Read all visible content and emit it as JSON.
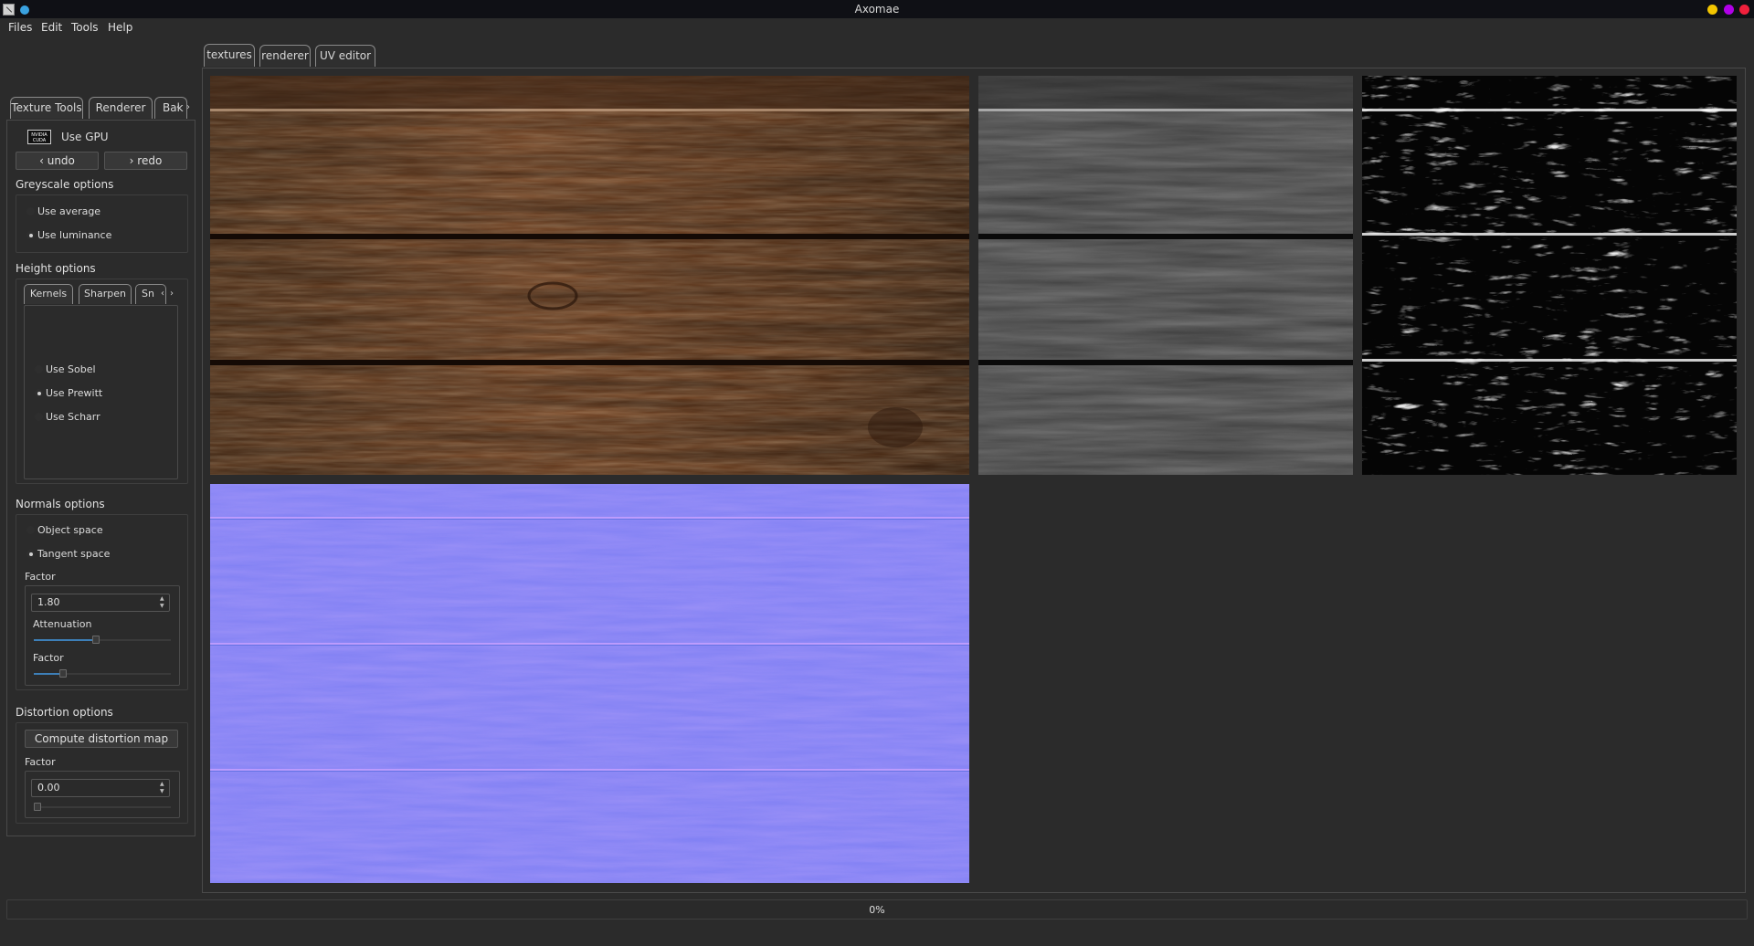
{
  "window": {
    "title": "Axomae"
  },
  "menu": [
    "Files",
    "Edit",
    "Tools",
    "Help"
  ],
  "left_tabs": [
    "Texture Tools",
    "Renderer",
    "Bak"
  ],
  "gpu": {
    "badge": "NVIDIA CUDA",
    "label": "Use GPU"
  },
  "history": {
    "undo": "undo",
    "redo": "redo"
  },
  "greyscale": {
    "title": "Greyscale options",
    "options": [
      "Use average",
      "Use luminance"
    ],
    "selected_index": 1
  },
  "height": {
    "title": "Height options",
    "tabs": [
      "Kernels",
      "Sharpen",
      "Sn"
    ],
    "options": [
      "Use Sobel",
      "Use Prewitt",
      "Use Scharr"
    ],
    "selected_index": 1
  },
  "normals": {
    "title": "Normals options",
    "options": [
      "Object space",
      "Tangent space"
    ],
    "selected_index": 1,
    "factor_label": "Factor",
    "factor_value": "1.80",
    "attenuation_label": "Attenuation",
    "attenuation_level": 0.45,
    "slider_factor_label": "Factor",
    "slider_factor_level": 0.2
  },
  "distortion": {
    "title": "Distortion options",
    "compute_label": "Compute distortion map",
    "factor_label": "Factor",
    "factor_value": "0.00",
    "factor_level": 0.0
  },
  "main_tabs": [
    "textures",
    "renderer",
    "UV editor"
  ],
  "textures": [
    "diffuse-texture",
    "greyscale-texture",
    "height-map-texture",
    "normal-map-texture"
  ],
  "progress": {
    "text": "0%",
    "value": 0
  },
  "colors": {
    "accent": "#3d7fb8",
    "wood": "#6a3a1c",
    "normal": "#8181f5"
  }
}
